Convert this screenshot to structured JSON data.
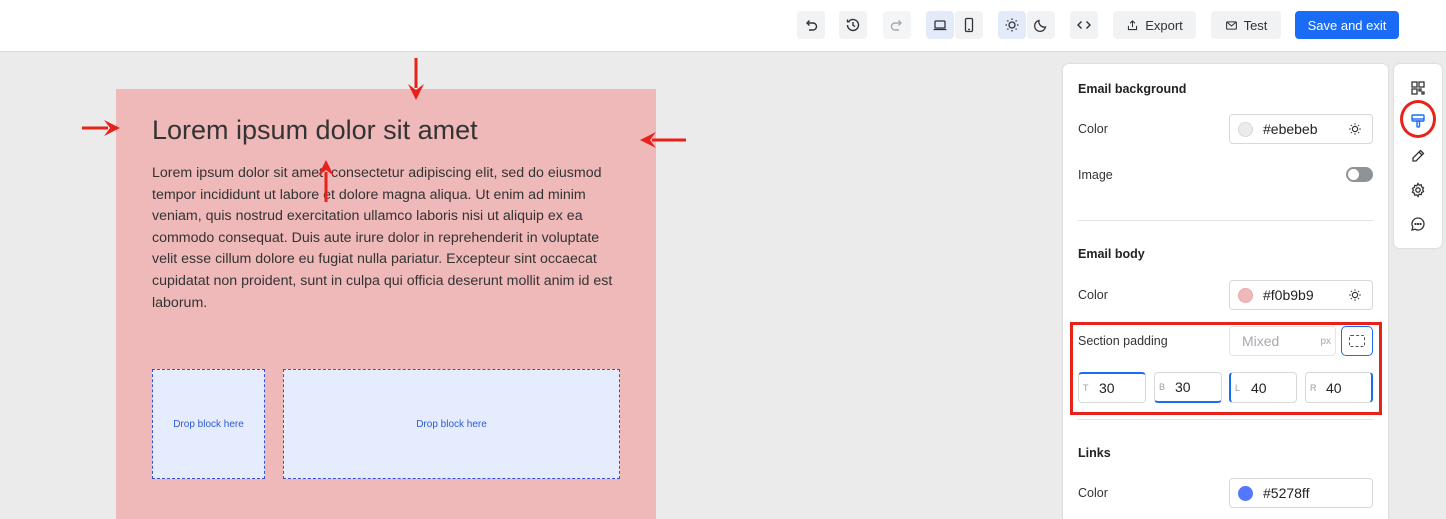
{
  "toolbar": {
    "undo_icon": "undo-icon",
    "history_icon": "history-icon",
    "redo_icon": "redo-icon",
    "desktop_icon": "laptop-icon",
    "mobile_icon": "phone-icon",
    "light_icon": "sun-icon",
    "dark_icon": "moon-icon",
    "code_icon": "code-icon",
    "export_label": "Export",
    "test_label": "Test",
    "save_label": "Save and exit",
    "accent_color": "#1a6bf5"
  },
  "email": {
    "body_color": "#f0b9b9",
    "heading": "Lorem ipsum dolor sit amet",
    "paragraph": "Lorem ipsum dolor sit amet, consectetur adipiscing elit, sed do eiusmod tempor incididunt ut labore et dolore magna aliqua. Ut enim ad minim veniam, quis nostrud exercitation ullamco laboris nisi ut aliquip ex ea commodo consequat. Duis aute irure dolor in reprehenderit in voluptate velit esse cillum dolore eu fugiat nulla pariatur. Excepteur sint occaecat cupidatat non proident, sunt in culpa qui officia deserunt mollit anim id est laborum.",
    "drop_left": "Drop block here",
    "drop_right": "Drop block here"
  },
  "settings": {
    "email_background": {
      "title": "Email background",
      "color_label": "Color",
      "color_value": "#ebebeb",
      "image_label": "Image"
    },
    "email_body": {
      "title": "Email body",
      "color_label": "Color",
      "color_value": "#f0b9b9",
      "padding_label": "Section padding",
      "padding_placeholder": "Mixed",
      "padding_unit": "px",
      "top_label": "T",
      "top_value": "30",
      "bottom_label": "B",
      "bottom_value": "30",
      "left_label": "L",
      "left_value": "40",
      "right_label": "R",
      "right_value": "40"
    },
    "links": {
      "title": "Links",
      "color_label": "Color",
      "color_value": "#5278ff"
    }
  },
  "sidebar": {
    "icons": [
      "grid-icon",
      "paint-roller-icon",
      "pencil-icon",
      "gear-icon",
      "chat-icon"
    ]
  },
  "annotations": {
    "highlight_color": "#e8221a"
  }
}
